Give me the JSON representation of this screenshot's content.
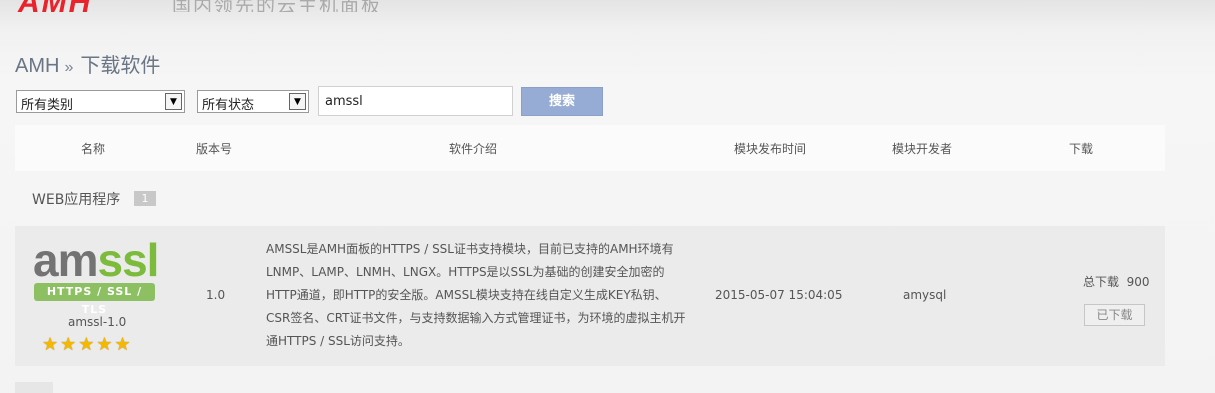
{
  "header": {
    "logo": "AMH",
    "tagline": "国内领先的云主机面板"
  },
  "breadcrumb": {
    "root": "AMH",
    "separator": "»",
    "page": "下载软件"
  },
  "filters": {
    "category": "所有类别",
    "state": "所有状态",
    "search_value": "amssl",
    "search_button": "搜索"
  },
  "table": {
    "columns": [
      "名称",
      "版本号",
      "软件介绍",
      "模块发布时间",
      "模块开发者",
      "下载"
    ],
    "group": {
      "label": "WEB应用程序",
      "count": "1"
    },
    "rows": [
      {
        "logo_left": "am",
        "logo_right": "ssl",
        "logo_badge": "HTTPS / SSL / TLS",
        "name": "amssl-1.0",
        "rating": 5,
        "stars": "★★★★★",
        "version": "1.0",
        "description": "AMSSL是AMH面板的HTTPS / SSL证书支持模块，目前已支持的AMH环境有LNMP、LAMP、LNMH、LNGX。HTTPS是以SSL为基础的创建安全加密的HTTP通道，即HTTP的安全版。AMSSL模块支持在线自定义生成KEY私钥、CSR签名、CRT证书文件，与支持数据输入方式管理证书，为环境的虚拟主机开通HTTPS / SSL访问支持。",
        "release_time": "2015-05-07 15:04:05",
        "developer": "amysql",
        "downloads_label": "总下载",
        "downloads": "900",
        "download_button": "已下载"
      }
    ]
  },
  "colors": {
    "accent": "#97acd4",
    "brand": "#e8232b",
    "ssl_green": "#7cbb3c"
  }
}
